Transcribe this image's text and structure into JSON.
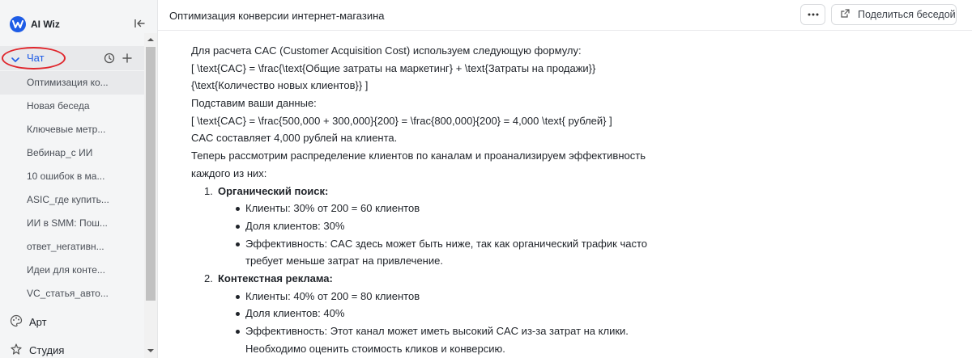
{
  "sidebar": {
    "brand": "AI Wiz",
    "chat_label": "Чат",
    "conversations": [
      "Оптимизация ко...",
      "Новая беседа",
      "Ключевые метр...",
      "Вебинар_с ИИ",
      "10 ошибок в ма...",
      "ASIC_где купить...",
      "ИИ в SMM: Пош...",
      "ответ_негативн...",
      "Идеи для конте...",
      "VC_статья_авто..."
    ],
    "art_label": "Арт",
    "studio_label": "Студия"
  },
  "header": {
    "title": "Оптимизация конверсии интернет-магазина",
    "more_label": "•••",
    "share_label": "Поделиться беседой"
  },
  "content": {
    "intro": "Для расчета CAC (Customer Acquisition Cost) используем следующую формулу:",
    "formula1": "[ \\text{CAC} = \\frac{\\text{Общие затраты на маркетинг} + \\text{Затраты на продажи}}",
    "formula1b": "{\\text{Количество новых клиентов}} ]",
    "substitute": "Подставим ваши данные:",
    "formula2": "[ \\text{CAC} = \\frac{500,000 + 300,000}{200} = \\frac{800,000}{200} = 4,000 \\text{ рублей} ]",
    "result": "CAC составляет 4,000 рублей на клиента.",
    "next1": "Теперь рассмотрим распределение клиентов по каналам и проанализируем эффективность",
    "next2": "каждого из них:",
    "list": [
      {
        "num": "1.",
        "title": "Органический поиск:",
        "clients": "Клиенты: 30% от 200 = 60 клиентов",
        "share": "Доля клиентов: 30%",
        "eff1": "Эффективность: CAC здесь может быть ниже, так как органический трафик часто",
        "eff2": "требует меньше затрат на привлечение."
      },
      {
        "num": "2.",
        "title": "Контекстная реклама:",
        "clients": "Клиенты: 40% от 200 = 80 клиентов",
        "share": "Доля клиентов: 40%",
        "eff1": "Эффективность: Этот канал может иметь высокий CAC из-за затрат на клики.",
        "eff2": "Необходимо оценить стоимость кликов и конверсию."
      }
    ]
  },
  "colors": {
    "accent": "#1e5ce6",
    "annotation_circle": "#e0262c"
  }
}
